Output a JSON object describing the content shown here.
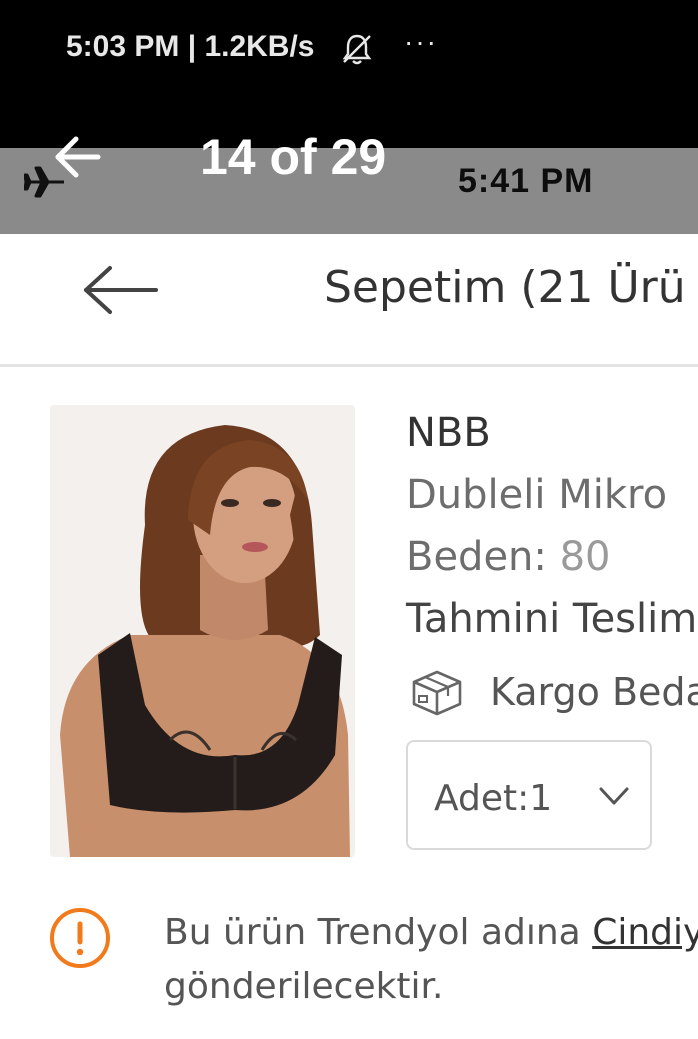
{
  "status_bar": {
    "text": "5:03 PM | 1.2KB/s",
    "more": "···"
  },
  "viewer": {
    "counter": "14 of 29"
  },
  "inner_status": {
    "time": "5:41 PM"
  },
  "header": {
    "title": "Sepetim (21 Ürü"
  },
  "product": {
    "brand": "NBB",
    "name": "Dubleli Mikro",
    "size_label": "Beden:",
    "size_value": "80",
    "delivery": "Tahmini Teslim",
    "cargo": "Kargo Bedav",
    "quantity_label": "Adet:",
    "quantity_value": "1"
  },
  "notice": {
    "line1_prefix": "Bu ürün Trendyol adına ",
    "seller": "Cindiy",
    "line2": "gönderilecektir."
  },
  "colors": {
    "accent": "#f27a1a",
    "status_bg": "#000000",
    "viewer_bg": "#8a8a8a"
  }
}
